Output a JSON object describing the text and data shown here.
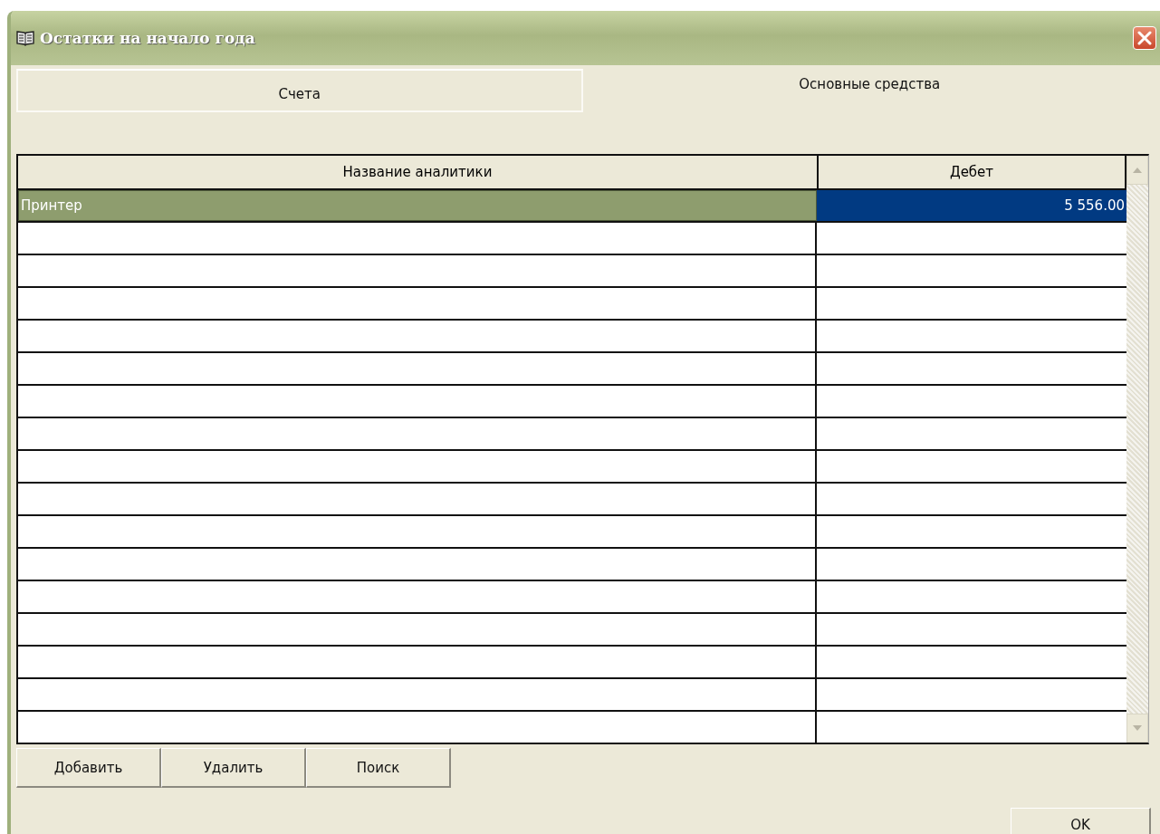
{
  "window": {
    "title": "Остатки на начало года"
  },
  "tabs": [
    {
      "label": "Счета",
      "selected": false
    },
    {
      "label": "Основные средства",
      "selected": true
    }
  ],
  "table": {
    "columns": [
      "Название аналитики",
      "Дебет"
    ],
    "rows": [
      {
        "name": "Принтер",
        "debit": "5 556.00",
        "selected": true
      }
    ]
  },
  "buttons": [
    "Добавить",
    "Удалить",
    "Поиск"
  ],
  "ok_button": "OK"
}
